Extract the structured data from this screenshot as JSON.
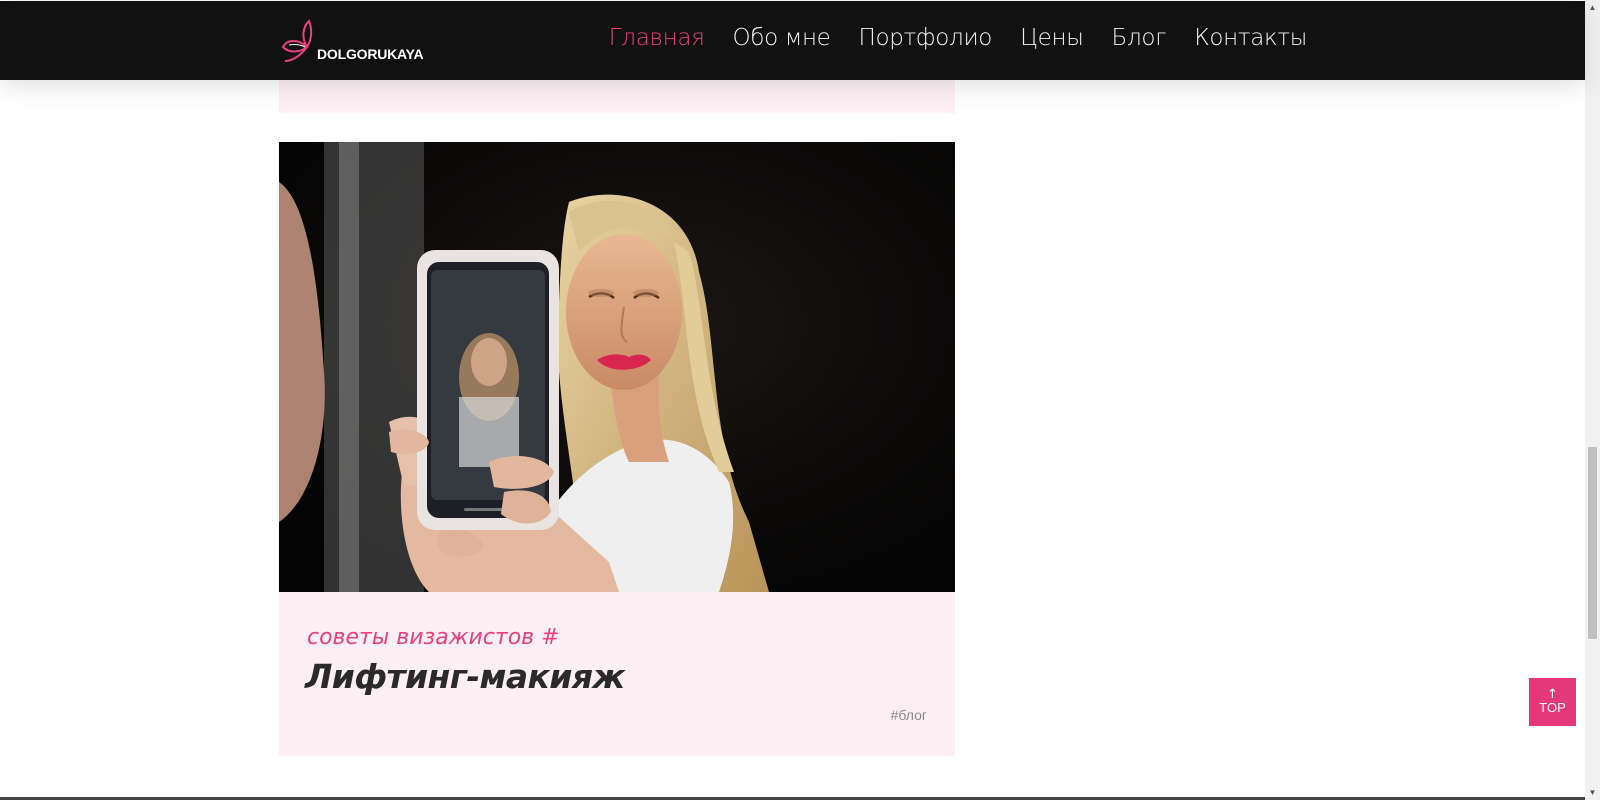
{
  "header": {
    "logo": {
      "text": "DOLGORUKAYA",
      "icon": "butterfly-logo-icon"
    },
    "nav": [
      {
        "label": "Главная",
        "active": true
      },
      {
        "label": "Обо мне",
        "active": false
      },
      {
        "label": "Портфолио",
        "active": false
      },
      {
        "label": "Цены",
        "active": false
      },
      {
        "label": "Блог",
        "active": false
      },
      {
        "label": "Контакты",
        "active": false
      }
    ]
  },
  "post": {
    "category": "советы визажистов #",
    "title": "Лифтинг-макияж",
    "tag": "#блог"
  },
  "top_button": {
    "label": "TOP",
    "arrow": "↑"
  },
  "colors": {
    "accent": "#e8417e",
    "header_bg": "#111111",
    "card_bg": "#fcf0f4",
    "title": "#2a2a2a"
  }
}
